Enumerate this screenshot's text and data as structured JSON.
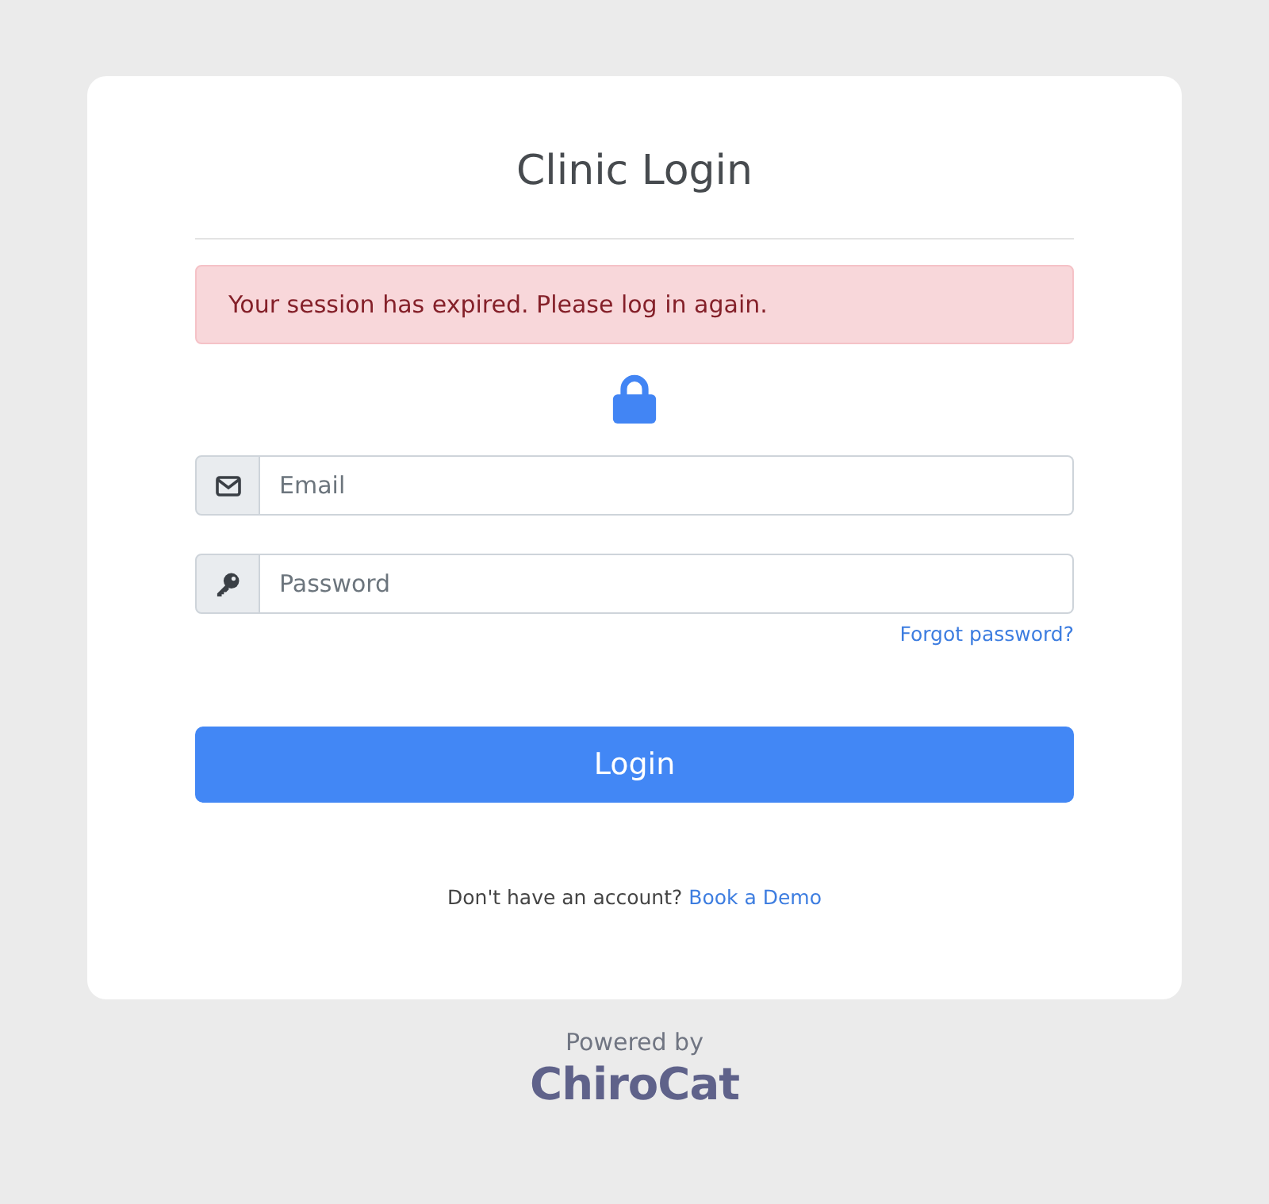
{
  "card": {
    "title": "Clinic Login"
  },
  "alert": {
    "kind": "error",
    "message": "Your session has expired. Please log in again."
  },
  "fields": [
    {
      "kind": "email",
      "placeholder": "Email"
    },
    {
      "kind": "password",
      "placeholder": "Password"
    }
  ],
  "forgot_link": "Forgot password?",
  "login_button": "Login",
  "signup": {
    "text": "Don't have an account?",
    "link": "Book a Demo"
  },
  "footer": {
    "powered_by": "Powered by",
    "brand": "ChiroCat"
  }
}
